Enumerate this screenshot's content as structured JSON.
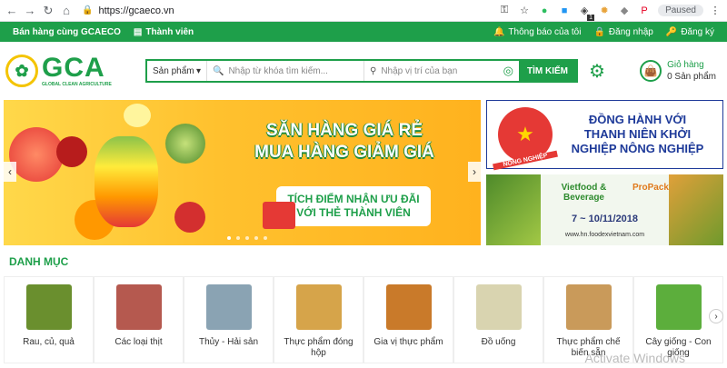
{
  "browser": {
    "url": "https://gcaeco.vn",
    "paused_label": "Paused",
    "ext_badge": "1"
  },
  "topbar": {
    "sell_label": "Bán hàng cùng GCAECO",
    "member_label": "Thành viên",
    "notify_label": "Thông báo của tôi",
    "login_label": "Đăng nhập",
    "register_label": "Đăng ký"
  },
  "logo": {
    "name": "GCA",
    "tagline": "GLOBAL CLEAN AGRICULTURE"
  },
  "search": {
    "category": "Sản phẩm",
    "keyword_placeholder": "Nhập từ khóa tìm kiếm...",
    "location_placeholder": "Nhập vị trí của bạn",
    "button": "TÌM KIẾM"
  },
  "cart": {
    "title": "Giỏ hàng",
    "count": "0 Sản phẩm"
  },
  "banner": {
    "headline1": "SĂN HÀNG GIÁ RẺ",
    "headline2": "MUA HÀNG GIẢM GIÁ",
    "promo1": "TÍCH ĐIỂM NHẬN ƯU ĐÃI",
    "promo2": "VỚI THẺ THÀNH VIÊN",
    "side_top_line1": "ĐỒNG HÀNH VỚI",
    "side_top_line2": "THANH NIÊN KHỞI",
    "side_top_line3": "NGHIỆP NÔNG NGHIỆP",
    "badge_label": "NÔNG NGHIỆP",
    "fair_logo1": "Vietfood & Beverage",
    "fair_logo2": "ProPack",
    "fair_date": "7 ~ 10/11/2018",
    "fair_url": "www.hn.foodexvietnam.com"
  },
  "section_title": "DANH MỤC",
  "categories": [
    {
      "label": "Rau, củ, quả",
      "color": "#6a8f2e"
    },
    {
      "label": "Các loại thịt",
      "color": "#b5594f"
    },
    {
      "label": "Thủy - Hải sản",
      "color": "#8aa3b3"
    },
    {
      "label": "Thực phẩm đóng hộp",
      "color": "#d6a44a"
    },
    {
      "label": "Gia vị thực phẩm",
      "color": "#c97a2a"
    },
    {
      "label": "Đồ uống",
      "color": "#d9d4b0"
    },
    {
      "label": "Thực phẩm chế biến sẵn",
      "color": "#c99a5a"
    },
    {
      "label": "Cây giống - Con giống",
      "color": "#5cae3c"
    }
  ],
  "watermark": "Activate Windows"
}
